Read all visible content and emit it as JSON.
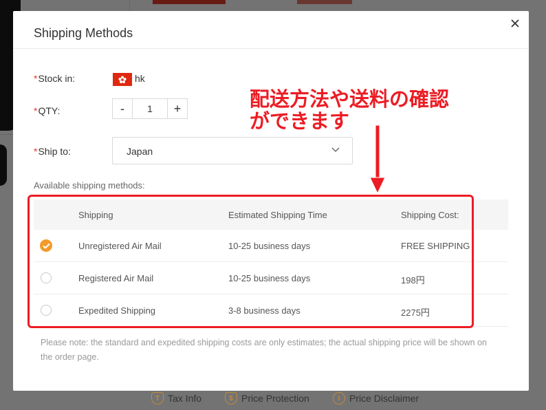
{
  "modal": {
    "title": "Shipping Methods",
    "close_icon": "close-icon"
  },
  "form": {
    "required_mark": "*",
    "stock_label": "Stock in:",
    "stock_value": "hk",
    "flag_icon": "hong-kong-flag-icon",
    "qty_label": "QTY:",
    "qty_minus": "-",
    "qty_value": "1",
    "qty_plus": "+",
    "ship_to_label": "Ship to:",
    "ship_to_value": "Japan",
    "ship_to_chevron": "chevron-down-icon"
  },
  "shipping": {
    "available_label": "Available shipping methods:",
    "headers": {
      "shipping": "Shipping",
      "time": "Estimated Shipping Time",
      "cost": "Shipping Cost:"
    },
    "rows": [
      {
        "name": "Unregistered Air Mail",
        "time": "10-25 business days",
        "cost": "FREE SHIPPING",
        "selected": true
      },
      {
        "name": "Registered Air Mail",
        "time": "10-25 business days",
        "cost": "198円",
        "selected": false
      },
      {
        "name": "Expedited Shipping",
        "time": "3-8 business days",
        "cost": "2275円",
        "selected": false
      }
    ],
    "note": "Please note: the standard and expedited shipping costs are only estimates; the actual shipping price will be shown on the order page."
  },
  "annotation": {
    "line1": "配送方法や送料の確認",
    "line2": "ができます",
    "color": "#ec1c24"
  },
  "footer_links": {
    "tax": "Tax Info",
    "tax_icon": "tax-icon",
    "price_protection": "Price Protection",
    "price_protection_icon": "shield-dollar-icon",
    "disclaimer": "Price Disclaimer",
    "disclaimer_icon": "info-icon"
  },
  "colors": {
    "accent_orange": "#f39a2b",
    "required_red": "#e4392b",
    "annotation_red": "#ec1c24"
  }
}
